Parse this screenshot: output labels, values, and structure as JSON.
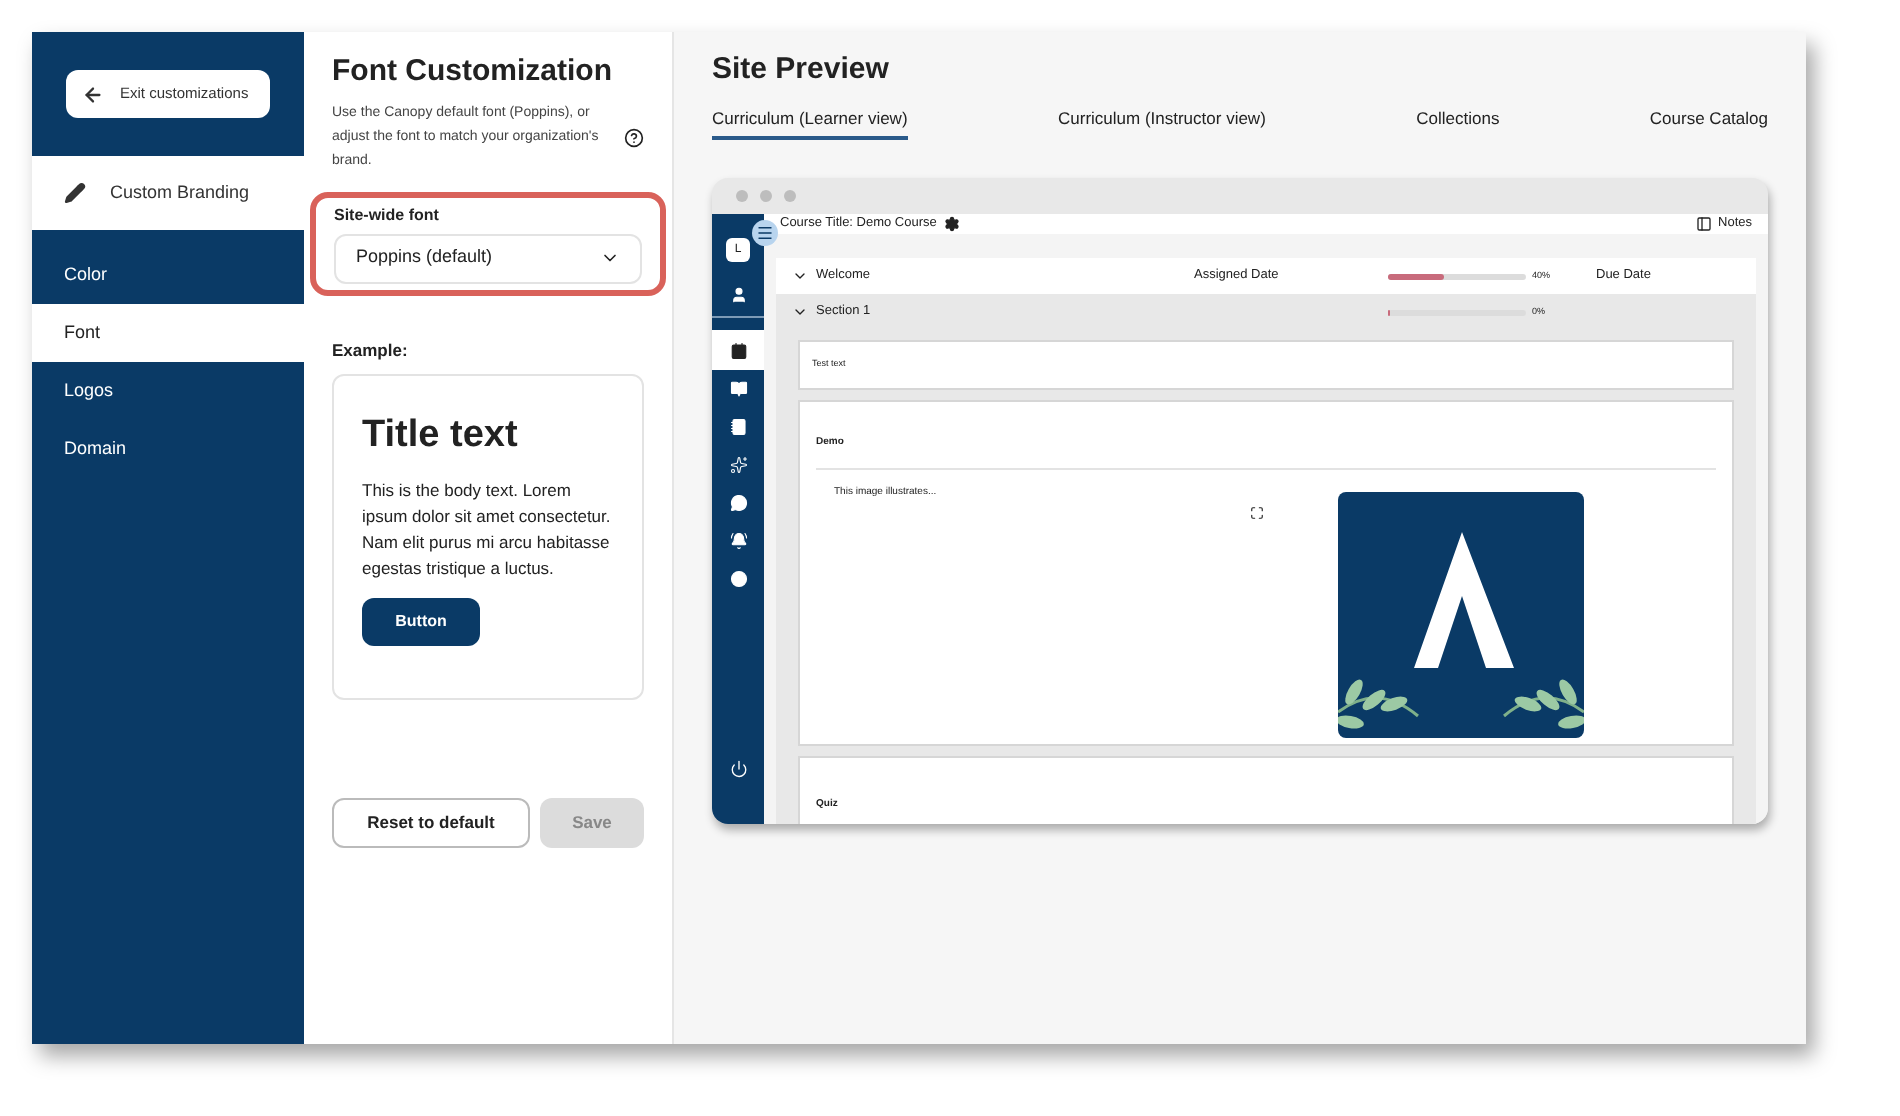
{
  "exit_button": {
    "label": "Exit customizations"
  },
  "section_header": {
    "label": "Custom Branding"
  },
  "nav": [
    {
      "label": "Color",
      "selected": false
    },
    {
      "label": "Font",
      "selected": true
    },
    {
      "label": "Logos",
      "selected": false
    },
    {
      "label": "Domain",
      "selected": false
    }
  ],
  "font_panel": {
    "title": "Font Customization",
    "description": "Use the Canopy default font (Poppins), or adjust the font to match your organization's brand.",
    "field_label": "Site-wide font",
    "font_select": {
      "value": "Poppins (default)"
    },
    "example_label": "Example:",
    "example": {
      "title": "Title text",
      "body": "This is the body text. Lorem ipsum dolor sit amet consectetur. Nam elit purus mi arcu habitasse egestas tristique a luctus.",
      "button": "Button"
    },
    "reset_button": "Reset to default",
    "save_button": {
      "label": "Save",
      "disabled": true
    }
  },
  "preview": {
    "title": "Site Preview",
    "tabs": [
      {
        "label": "Curriculum (Learner view)",
        "selected": true
      },
      {
        "label": "Curriculum (Instructor view)",
        "selected": false
      },
      {
        "label": "Collections",
        "selected": false
      },
      {
        "label": "Course Catalog",
        "selected": false
      }
    ],
    "avatar": "L",
    "nav_icons": [
      {
        "kind": "person",
        "selected": false
      },
      {
        "kind": "contact",
        "selected": true
      },
      {
        "kind": "book",
        "selected": false
      },
      {
        "kind": "notebook",
        "selected": false
      },
      {
        "kind": "sparkle",
        "selected": false
      },
      {
        "kind": "chat",
        "selected": false
      },
      {
        "kind": "bell",
        "selected": false
      },
      {
        "kind": "plus",
        "selected": false
      },
      {
        "kind": "power",
        "selected": false
      }
    ],
    "course_title": "Course Title: Demo Course",
    "notes": "Notes",
    "sections": [
      {
        "name": "Welcome",
        "expanded": true,
        "assigned": "Assigned Date",
        "level": 0.4,
        "percent": "40%",
        "due": "Due Date"
      },
      {
        "name": "Section 1",
        "expanded": true,
        "level": 0,
        "percent": "0%"
      }
    ],
    "lessons": [
      {
        "kind": "text",
        "text": "Test text"
      },
      {
        "kind": "media",
        "title": "Demo",
        "text": "This image illustrates..."
      },
      {
        "kind": "heading",
        "title": "Quiz"
      }
    ]
  }
}
